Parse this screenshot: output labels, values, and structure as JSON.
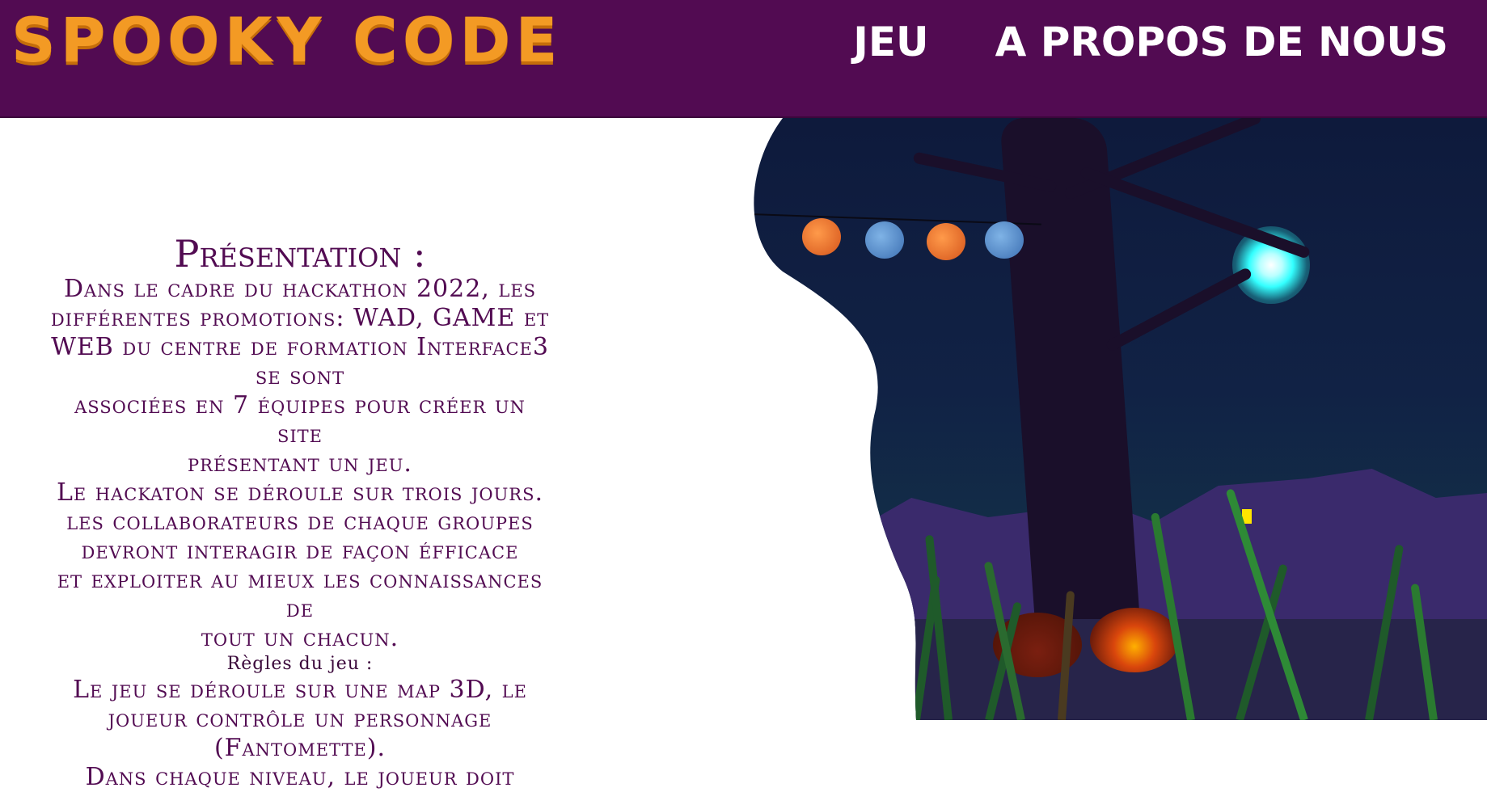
{
  "header": {
    "logo": "SPOOKY CODE",
    "nav": [
      {
        "label": "JEU"
      },
      {
        "label": "A PROPOS DE NOUS"
      }
    ],
    "background_color": "#520b52",
    "logo_color": "#f39a24"
  },
  "presentation": {
    "title": "Présentation :",
    "intro_lines": [
      "Dans le cadre du hackathon 2022, les",
      "différentes promotions: WAD, GAME et",
      "WEB du centre de formation Interface3",
      "se sont",
      "associées en 7 équipes pour créer un site",
      "présentant un jeu.",
      "Le hackaton se déroule sur trois jours.",
      "les collaborateurs de chaque groupes",
      "devront interagir de façon éfficace",
      "et exploiter au mieux les connaissances de",
      "tout un chacun."
    ],
    "rules_label": "Règles du jeu :",
    "rules_lines": [
      "Le jeu se déroule sur une map 3D, le",
      "joueur contrôle un personnage",
      "(Fantomette).",
      "Dans chaque niveau, le joueur doit"
    ],
    "text_color": "#520b52"
  },
  "hero_image": {
    "description_icon": "halloween-scene-image"
  }
}
